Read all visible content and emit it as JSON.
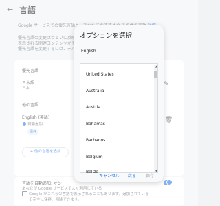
{
  "header": {
    "back_icon": "arrow-left-icon",
    "title": "言語"
  },
  "intro": {
    "line1": "Google サービスでの優先言語と、あなたにおすすめの その他の言語",
    "link": "詳細",
    "line2": "優先言語の変更はウェブに反映されます",
    "line3": "表示される関連コンテンツが多くなる",
    "line4": "優先言語を変更するには、デバイスの"
  },
  "preferred": {
    "title": "優先言語",
    "language": "日本語",
    "country": "日本"
  },
  "other": {
    "title": "他の言語",
    "language": "English (英語)",
    "auto": "自動追加",
    "save": "保存",
    "add_button": "+ 他の言語を追加"
  },
  "auto_add": {
    "title": "言語を自動追加: オン",
    "line1": "あなたが Google サービスでよく利用している",
    "line2": "Google がこれらの言語で表示されることもあります。追加されている",
    "line3": "で完全に保存、削除できます。"
  },
  "dialog": {
    "title": "オプションを選択",
    "selected": "English",
    "options": [
      "United States",
      "Australia",
      "Austria",
      "Bahamas",
      "Barbados",
      "Belgium",
      "Belize"
    ],
    "cancel": "キャンセル",
    "back": "戻る",
    "save": "保存"
  },
  "colors": {
    "accent": "#1a73e8",
    "background": "#f1f3f4"
  }
}
